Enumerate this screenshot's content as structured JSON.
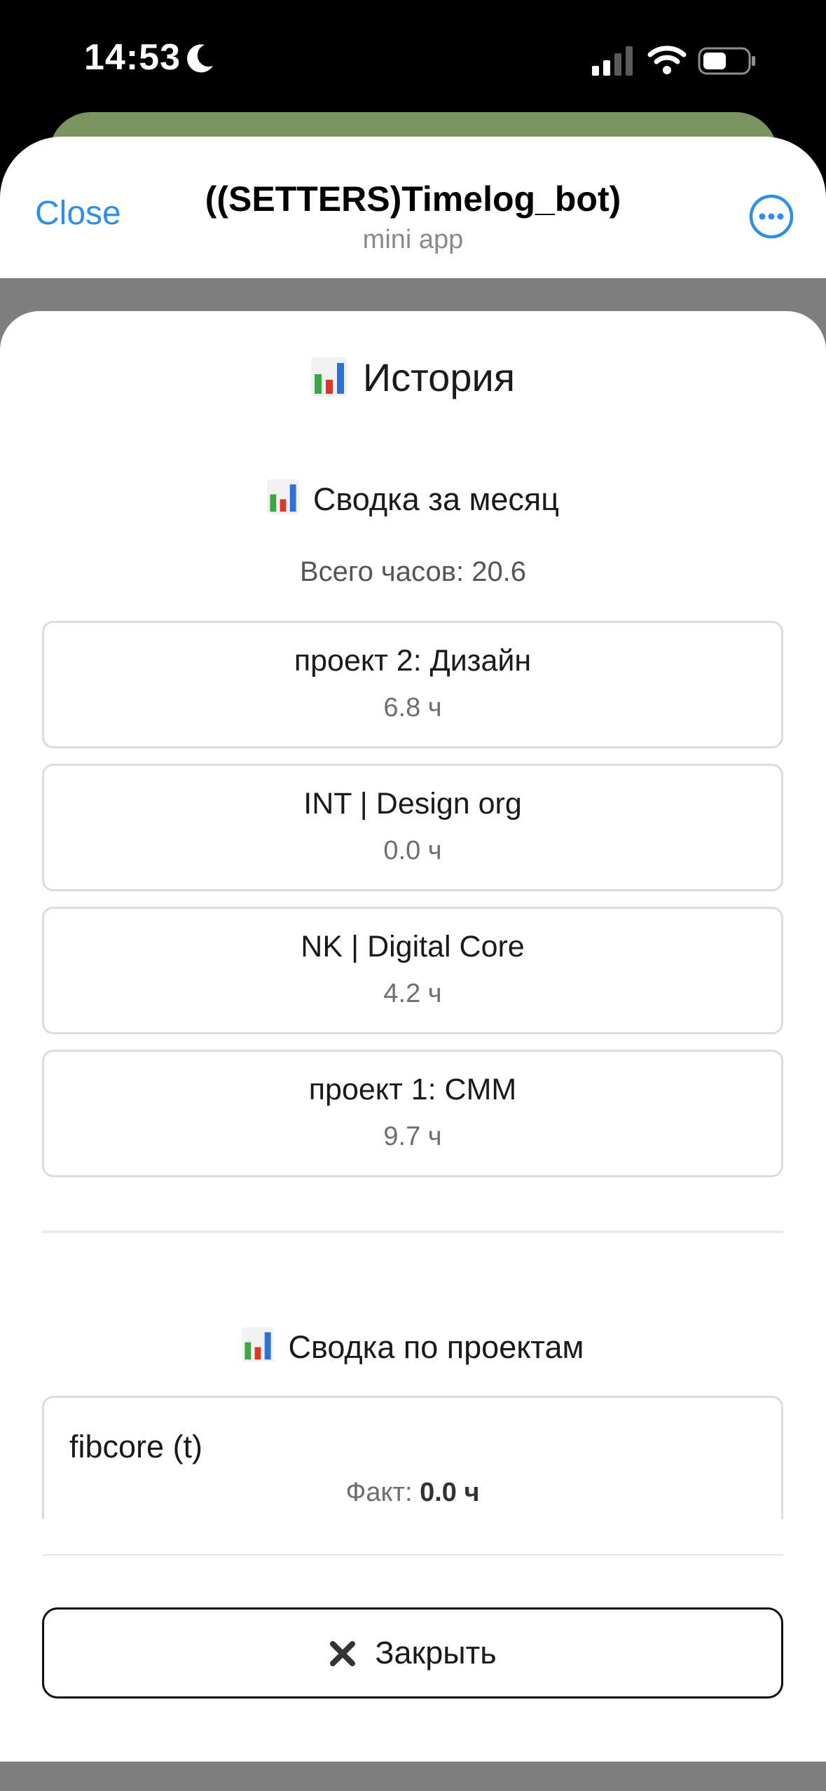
{
  "status_bar": {
    "time": "14:53"
  },
  "telegram_header": {
    "close_label": "Close",
    "bot_title": "((SETTERS)Timelog_bot)",
    "bot_subtitle": "mini app"
  },
  "app": {
    "title": "История",
    "monthly_summary": {
      "heading": "Сводка за месяц",
      "total_hours": "Всего часов: 20.6",
      "projects": [
        {
          "name": "проект 2: Дизайн",
          "hours": "6.8 ч"
        },
        {
          "name": "INT | Design org",
          "hours": "0.0 ч"
        },
        {
          "name": "NK | Digital Core",
          "hours": "4.2 ч"
        },
        {
          "name": "проект 1: CMM",
          "hours": "9.7 ч"
        }
      ]
    },
    "project_summary": {
      "heading": "Сводка по проектам",
      "items": [
        {
          "name": "fibcore (t)",
          "fact_label": "Факт:",
          "fact_value": "0.0 ч"
        }
      ]
    },
    "close_button_label": "Закрыть"
  },
  "icons": [
    "moon-icon",
    "cellular-icon",
    "wifi-icon",
    "battery-icon",
    "more-icon",
    "chart-icon",
    "close-x-icon"
  ],
  "colors": {
    "accent": "#2f8ee5",
    "chart_red": "#d9382b",
    "chart_green": "#3aa845",
    "chart_blue": "#2f6fd6"
  }
}
